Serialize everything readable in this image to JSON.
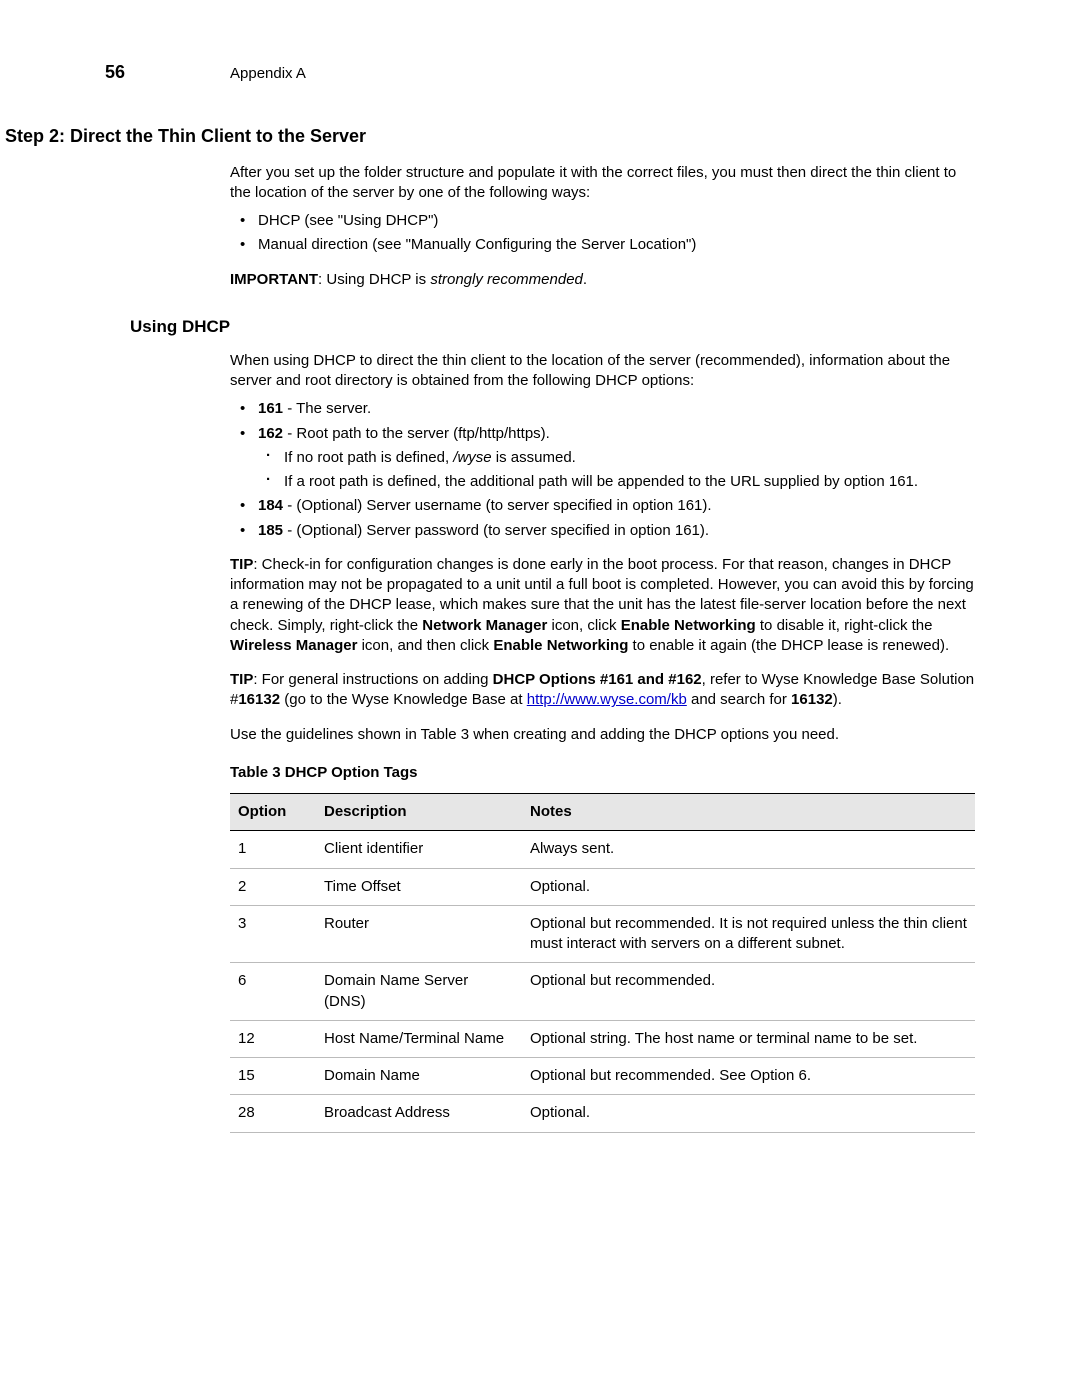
{
  "header": {
    "page_number": "56",
    "section": "Appendix A"
  },
  "step2": {
    "title": "Step 2: Direct the Thin Client to the Server",
    "intro": "After you set up the folder structure and populate it with the correct files, you must then direct the thin client to the location of the server by one of the following ways:",
    "methods": [
      "DHCP (see \"Using DHCP\")",
      "Manual direction (see \"Manually Configuring the Server Location\")"
    ],
    "important_label": "IMPORTANT",
    "important_text": ": Using DHCP is ",
    "important_emph": "strongly recommended",
    "important_tail": "."
  },
  "using_dhcp": {
    "title": "Using DHCP",
    "intro": "When using DHCP to direct the thin client to the location of the server (recommended), information about the server and root directory is obtained from the following DHCP options:",
    "opts": {
      "o161_num": "161",
      "o161_text": " - The server.",
      "o162_num": "162",
      "o162_text": " - Root path to the server (ftp/http/https).",
      "o162_sub1_a": "If no root path is defined, ",
      "o162_sub1_em": "/wyse",
      "o162_sub1_b": "  is assumed.",
      "o162_sub2": "If a root path is defined, the additional path will be appended to the URL supplied by option 161.",
      "o184_num": "184",
      "o184_text": " - (Optional) Server username (to server specified in option 161).",
      "o185_num": "185",
      "o185_text": " - (Optional) Server password (to server specified in option 161)."
    },
    "tip1": {
      "label": "TIP",
      "a": ": Check-in for configuration changes is done early in the boot process. For that reason, changes in DHCP information may not be propagated to a unit until a full boot is completed. However, you can avoid this by forcing a renewing of the DHCP lease, which makes sure that the unit has the latest file-server location before the next check. Simply, right-click the ",
      "b1": "Network Manager",
      "c": " icon, click ",
      "b2": "Enable Networking",
      "d": " to disable it, right-click the ",
      "b3": "Wireless Manager",
      "e": " icon, and then click ",
      "b4": "Enable Networking",
      "f": " to enable it again (the DHCP lease is renewed)."
    },
    "tip2": {
      "label": "TIP",
      "a": ": For general instructions on adding ",
      "b1": "DHCP Options #161 and #162",
      "c": ", refer to Wyse Knowledge Base Solution #",
      "b2": "16132",
      "d": " (go to the Wyse Knowledge Base at ",
      "link_text": "http://www.wyse.com/kb",
      "e": " and search for ",
      "b3": "16132",
      "f": ")."
    },
    "guidelines": "Use the guidelines shown in Table 3 when creating and adding the DHCP options you need."
  },
  "table": {
    "caption": "Table 3    DHCP Option Tags",
    "headers": {
      "option": "Option",
      "description": "Description",
      "notes": "Notes"
    },
    "rows": [
      {
        "option": "1",
        "description": "Client identifier",
        "notes": "Always sent."
      },
      {
        "option": "2",
        "description": "Time Offset",
        "notes": "Optional."
      },
      {
        "option": "3",
        "description": "Router",
        "notes": "Optional but recommended. It is not required unless the thin client must interact with servers on a different subnet."
      },
      {
        "option": "6",
        "description": "Domain Name Server (DNS)",
        "notes": "Optional but recommended."
      },
      {
        "option": "12",
        "description": "Host Name/Terminal Name",
        "notes": "Optional string. The host name or terminal name to be set."
      },
      {
        "option": "15",
        "description": "Domain Name",
        "notes": "Optional but recommended. See Option 6."
      },
      {
        "option": "28",
        "description": "Broadcast Address",
        "notes": "Optional."
      }
    ]
  }
}
